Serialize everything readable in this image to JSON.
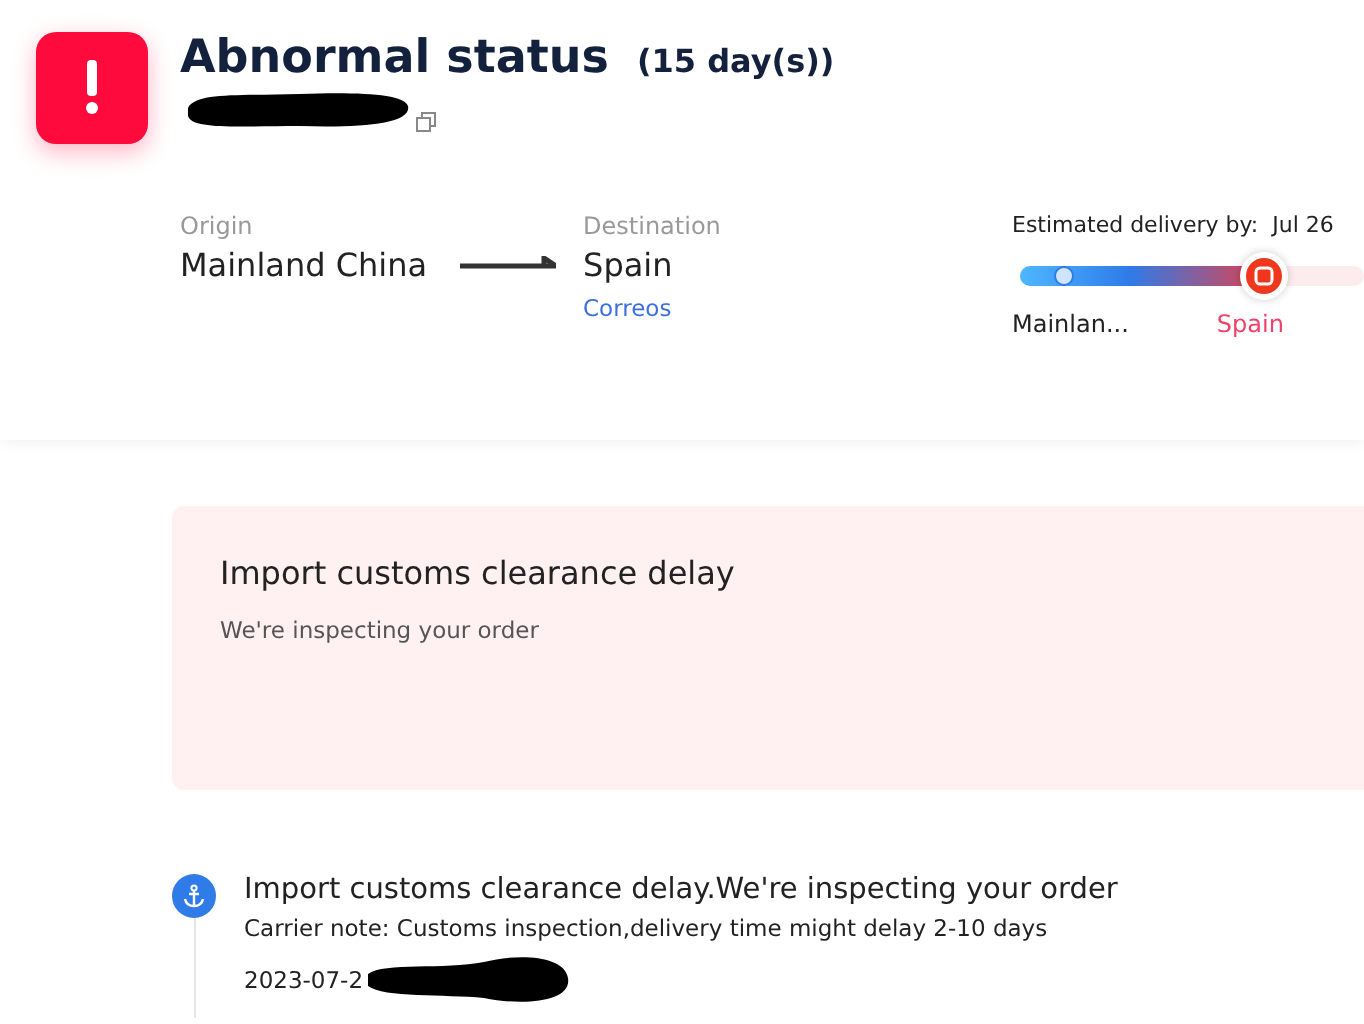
{
  "status": {
    "title": "Abnormal status",
    "duration": "(15 day(s))"
  },
  "route": {
    "origin_label": "Origin",
    "origin": "Mainland China",
    "destination_label": "Destination",
    "destination": "Spain",
    "carrier": "Correos"
  },
  "delivery": {
    "label": "Estimated delivery by:",
    "date": "Jul 26",
    "level": 0.71,
    "stops": [
      {
        "label": "Mainlan...",
        "selected": false
      },
      {
        "label": "Spain",
        "selected": true
      }
    ]
  },
  "alert": {
    "title": "Import customs clearance delay",
    "message": "We're inspecting your order"
  },
  "events": [
    {
      "title": "Import customs clearance delay.We're inspecting your order",
      "note": "Carrier note: Customs inspection,delivery time might delay 2-10 days",
      "date": "2023-07-2"
    }
  ]
}
